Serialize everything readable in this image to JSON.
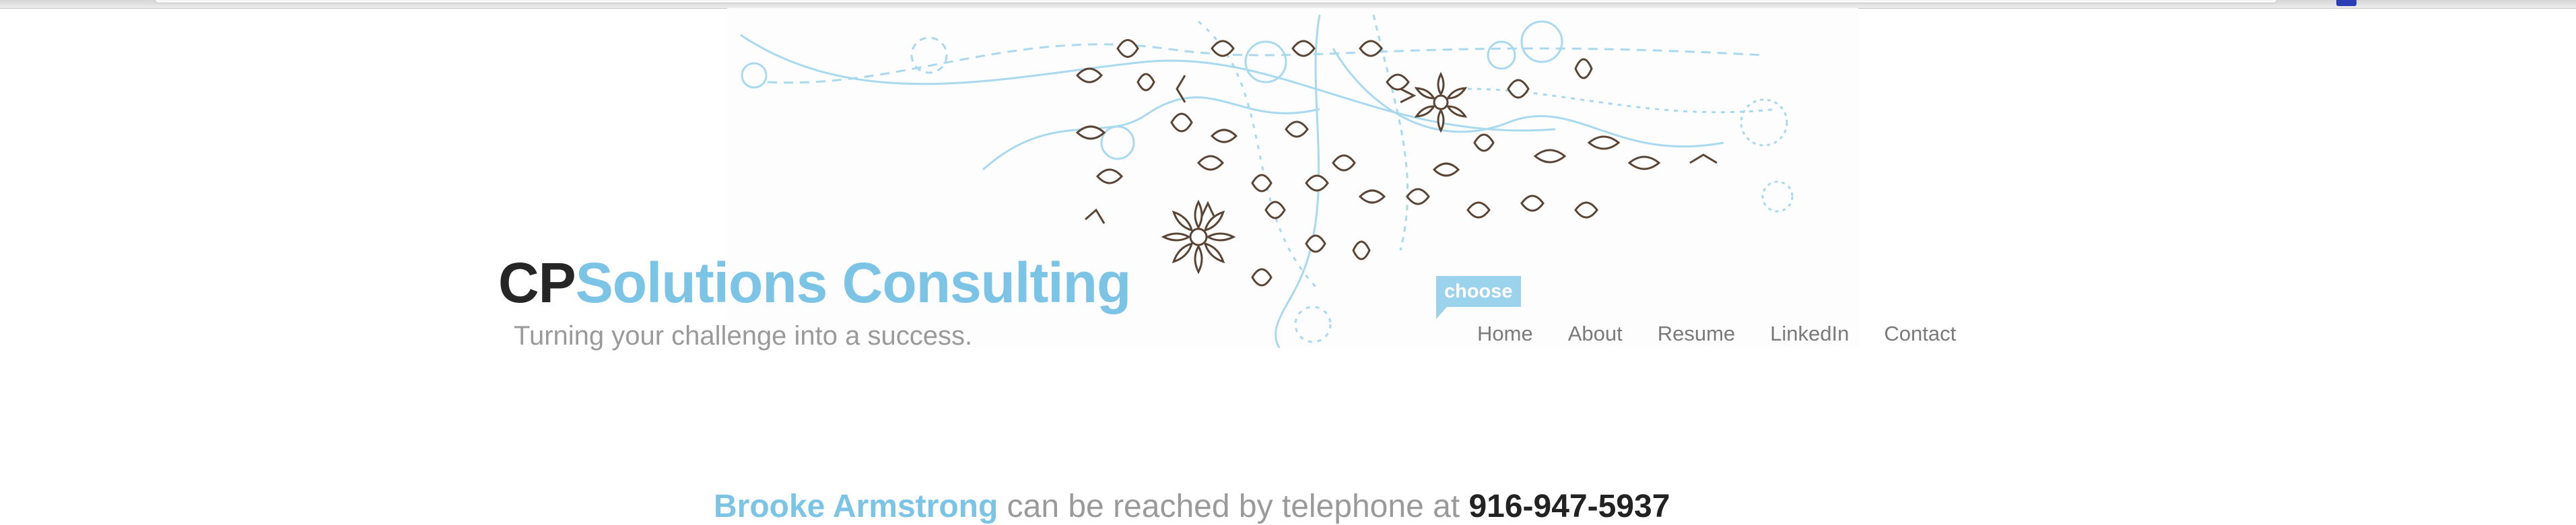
{
  "header": {
    "brand_prefix": "CP",
    "brand_rest": "Solutions Consulting",
    "tagline": "Turning your challenge into a success."
  },
  "choose_label": "choose",
  "nav": {
    "items": [
      "Home",
      "About",
      "Resume",
      "LinkedIn",
      "Contact"
    ]
  },
  "contact": {
    "name": "Brooke Armstrong",
    "text": " can be reached by telephone at ",
    "phone": "916-947-5937"
  },
  "colors": {
    "accent": "#7cc4e6",
    "dark": "#262626",
    "muted": "#9a9a9a",
    "leaf": "#5a4534"
  },
  "icons": {
    "banner": "floral-vine-illustration"
  }
}
